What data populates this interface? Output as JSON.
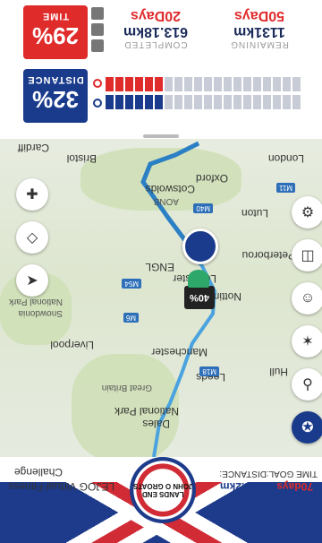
{
  "summary": {
    "time_pct": "29%",
    "time_label": "TIME",
    "distance_pct": "32%",
    "distance_label": "DISTANCE",
    "completed_days": "20Days",
    "completed_distance": "613.18km",
    "completed_label": "COMPLETED",
    "remaining_days": "50Days",
    "remaining_distance": "1131km",
    "remaining_label": "REMAINING",
    "time_progress": 0.29,
    "distance_progress": 0.32
  },
  "map": {
    "places": [
      "Cardiff",
      "Bristol",
      "London",
      "Oxford",
      "Cotswolds",
      "AONB",
      "Luton",
      "ENGL",
      "Peterborou",
      "Leicester",
      "Nottingham",
      "National Park",
      "Snowdonia",
      "Liverpool",
      "Manchester",
      "Leeds",
      "Hull",
      "Great Britain",
      "National Park",
      "Dales"
    ],
    "roads": [
      "M40",
      "M11",
      "M54",
      "M6",
      "M18"
    ],
    "marker_label": "40%"
  },
  "footer": {
    "title": "LEJOG Virtual Fitness",
    "subtitle": "Challenge",
    "medal_top": "JOHN O GROATS",
    "medal_bottom": "LANDS END",
    "distance_label": "DISTANCE:",
    "distance_value": "1744.2km",
    "goal_label": "TIME GOAL:",
    "goal_value": "70days"
  },
  "colors": {
    "red": "#e02b2b",
    "navy": "#1a3b8c",
    "route": "#4aa3df"
  },
  "controls": {
    "left": [
      "layers-icon",
      "navigation-arrow-icon",
      "center-icon"
    ],
    "right": [
      "settings-icon",
      "camera-icon",
      "person-icon",
      "running-icon",
      "cycling-icon",
      "medal-icon"
    ]
  }
}
